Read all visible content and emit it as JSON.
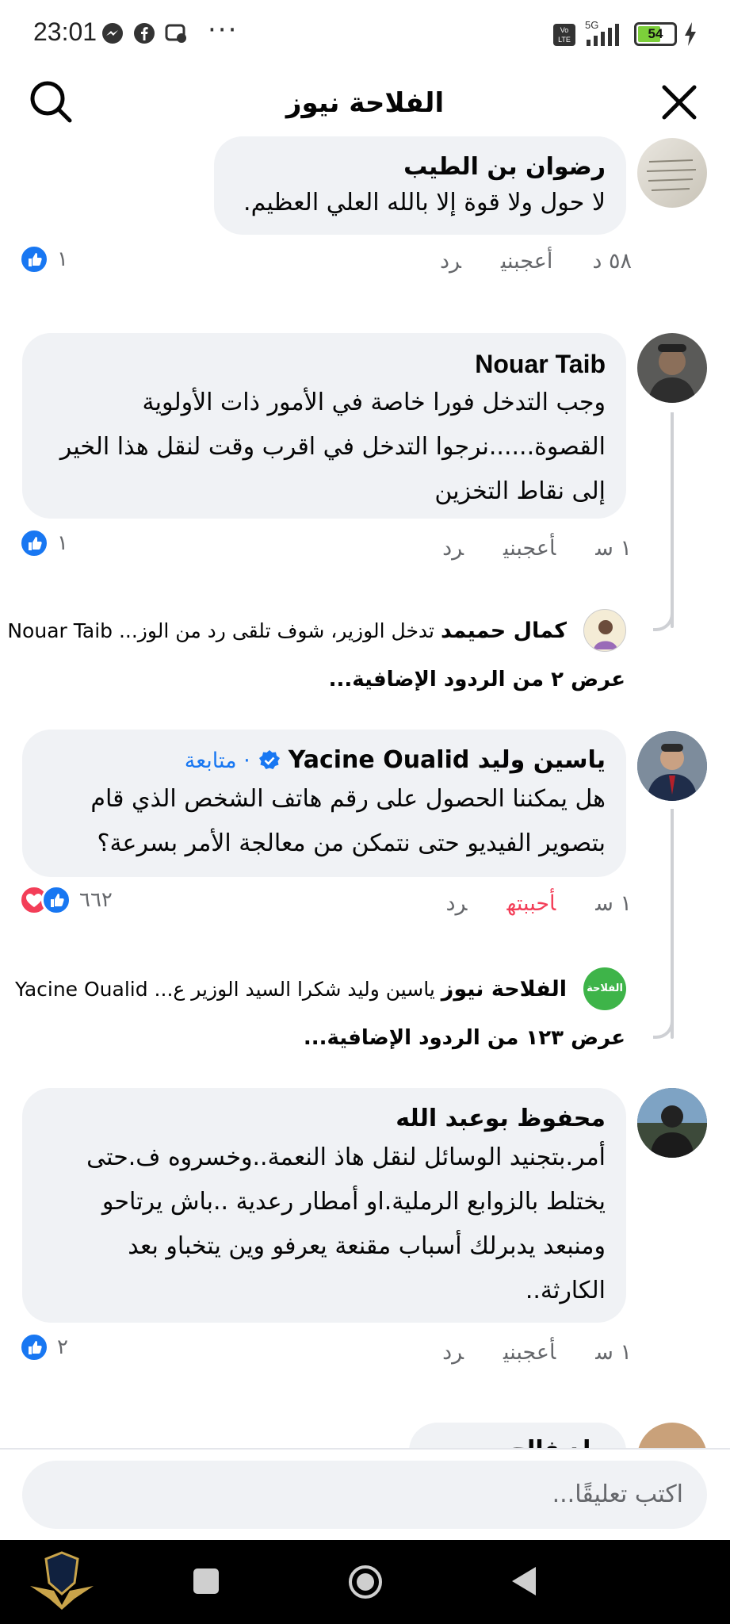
{
  "status_bar": {
    "time": "23:01",
    "network": "5G",
    "volte": "Vo LTE",
    "battery": "54"
  },
  "header": {
    "title": "الفلاحة نيوز"
  },
  "comments": [
    {
      "author": "رضوان بن الطيب",
      "text": "لا حول ولا قوة إلا بالله العلي العظيم.",
      "time": "٥٨ د",
      "like_label": "أعجبني",
      "reply_label": "رد",
      "reaction_count": "١"
    },
    {
      "author": "Nouar Taib",
      "lines": [
        "وجب التدخل فورا خاصة في الأمور ذات الأولوية",
        "القصوة......نرجوا التدخل في اقرب وقت لنقل هذا الخير",
        "إلى نقاط التخزين"
      ],
      "time": "١ س",
      "like_label": "أعجبني",
      "reply_label": "رد",
      "reaction_count": "١",
      "reply_preview": {
        "author": "كمال حميمد",
        "text": "تدخل الوزير، شوف تلقى رد من الوز... Nouar Taib"
      },
      "more_replies": "عرض ٢ من الردود الإضافية..."
    },
    {
      "author": "ياسين وليد Yacine Oualid",
      "follow_label": "· متابعة",
      "lines": [
        "هل يمكننا الحصول على رقم هاتف الشخص الذي قام",
        "بتصوير الفيديو حتى نتمكن من معالجة الأمر بسرعة؟"
      ],
      "time": "١ س",
      "like_label": "أحببته",
      "reply_label": "رد",
      "reaction_count": "٦٦٢",
      "reply_preview": {
        "author": "الفلاحة نيوز",
        "text": "ياسين وليد شكرا السيد الوزير ع... Yacine Oualid"
      },
      "more_replies": "عرض ١٢٣ من الردود الإضافية..."
    },
    {
      "author": "محفوظ بوعبد الله",
      "lines": [
        "أمر.بتجنيد الوسائل لنقل هاذ النعمة..وخسروه ف.حتى",
        "يختلط بالزوابع الرملية.او أمطار رعدية ..باش يرتاحو",
        "ومنبعد يدبرلك أسباب مقنعة يعرفو وين يتخباو بعد",
        "الكارثة.."
      ],
      "time": "١ س",
      "like_label": "أعجبني",
      "reply_label": "رد",
      "reaction_count": "٢"
    },
    {
      "author": "ولد فالح"
    }
  ],
  "input": {
    "placeholder": "اكتب تعليقًا..."
  },
  "colors": {
    "like_blue": "#1877f2",
    "love_red": "#f33e58",
    "bubble_bg": "#f0f2f5",
    "follow_blue": "#1877f2"
  }
}
